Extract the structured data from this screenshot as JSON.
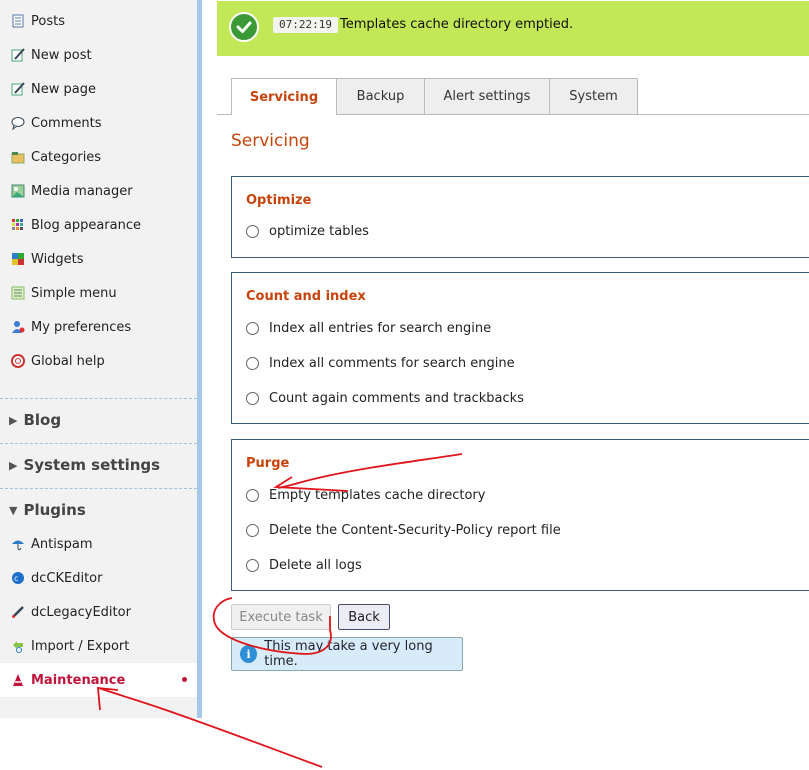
{
  "sidebar": {
    "items": [
      {
        "label": "Posts",
        "icon": "posts-icon"
      },
      {
        "label": "New post",
        "icon": "new-post-icon"
      },
      {
        "label": "New page",
        "icon": "new-page-icon"
      },
      {
        "label": "Comments",
        "icon": "comments-icon"
      },
      {
        "label": "Categories",
        "icon": "categories-icon"
      },
      {
        "label": "Media manager",
        "icon": "media-manager-icon"
      },
      {
        "label": "Blog appearance",
        "icon": "blog-appearance-icon"
      },
      {
        "label": "Widgets",
        "icon": "widgets-icon"
      },
      {
        "label": "Simple menu",
        "icon": "simple-menu-icon"
      },
      {
        "label": "My preferences",
        "icon": "preferences-icon"
      },
      {
        "label": "Global help",
        "icon": "help-icon"
      }
    ],
    "sections": [
      {
        "label": "Blog",
        "state": "collapsed"
      },
      {
        "label": "System settings",
        "state": "collapsed"
      },
      {
        "label": "Plugins",
        "state": "expanded"
      }
    ],
    "plugins": [
      {
        "label": "Antispam",
        "icon": "antispam-icon"
      },
      {
        "label": "dcCKEditor",
        "icon": "ckeditor-icon"
      },
      {
        "label": "dcLegacyEditor",
        "icon": "legacy-editor-icon"
      },
      {
        "label": "Import / Export",
        "icon": "import-export-icon"
      },
      {
        "label": "Maintenance",
        "icon": "maintenance-icon",
        "active": true
      }
    ]
  },
  "message": {
    "time": "07:22:19",
    "text": "Templates cache directory emptied.",
    "color": "#c2e857"
  },
  "tabs": [
    {
      "label": "Servicing",
      "active": true
    },
    {
      "label": "Backup"
    },
    {
      "label": "Alert settings"
    },
    {
      "label": "System"
    }
  ],
  "page_title": "Servicing",
  "groups": [
    {
      "title": "Optimize",
      "options": [
        "optimize tables"
      ]
    },
    {
      "title": "Count and index",
      "options": [
        "Index all entries for search engine",
        "Index all comments for search engine",
        "Count again comments and trackbacks"
      ]
    },
    {
      "title": "Purge",
      "options": [
        "Empty templates cache directory",
        "Delete the Content-Security-Policy report file",
        "Delete all logs"
      ]
    }
  ],
  "buttons": {
    "execute": "Execute task",
    "back": "Back"
  },
  "info": {
    "text": "This may take a very long time."
  },
  "colors": {
    "accent": "#c9440b",
    "active_plugin": "#c0153a",
    "annotation": "#e0151b"
  }
}
